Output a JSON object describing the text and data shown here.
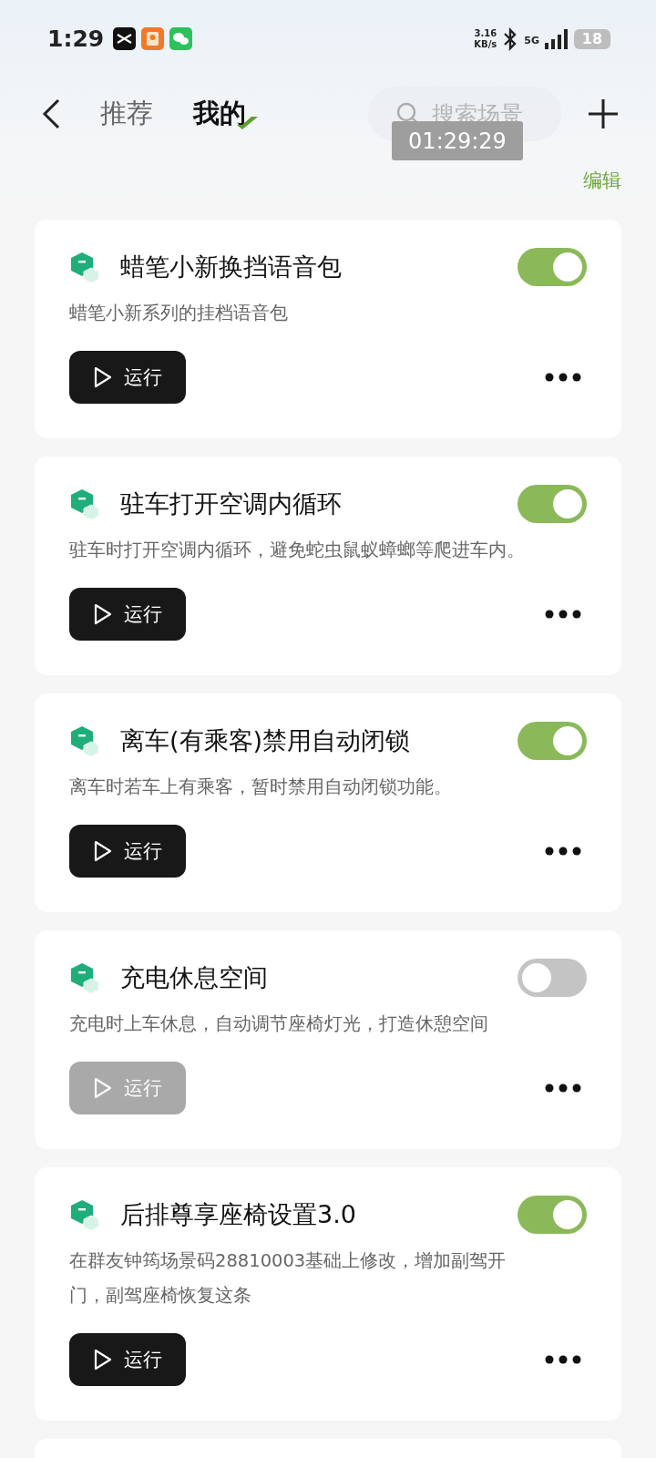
{
  "status_bar": {
    "time": "1:29",
    "net_speed": "3.16",
    "net_unit": "KB/s",
    "network": "5G",
    "battery": "18"
  },
  "header": {
    "tabs": [
      {
        "label": "推荐",
        "selected": false
      },
      {
        "label": "我的",
        "selected": true
      }
    ],
    "search": {
      "placeholder": "搜索场景"
    },
    "timer": "01:29:29"
  },
  "edit_label": "编辑",
  "scenes": [
    {
      "title": "蜡笔小新换挡语音包",
      "description": "蜡笔小新系列的挂档语音包",
      "on": true,
      "run_label": "运行"
    },
    {
      "title": "驻车打开空调内循环",
      "description": "驻车时打开空调内循环，避免蛇虫鼠蚁蟑螂等爬进车内。",
      "on": true,
      "run_label": "运行"
    },
    {
      "title": "离车(有乘客)禁用自动闭锁",
      "description": "离车时若车上有乘客，暂时禁用自动闭锁功能。",
      "on": true,
      "run_label": "运行"
    },
    {
      "title": "充电休息空间",
      "description": "充电时上车休息，自动调节座椅灯光，打造休憩空间",
      "on": false,
      "run_label": "运行"
    },
    {
      "title": "后排尊享座椅设置3.0",
      "description": "在群友钟筠场景码28810003基础上修改，增加副驾开门，副驾座椅恢复这条",
      "on": true,
      "run_label": "运行"
    }
  ]
}
